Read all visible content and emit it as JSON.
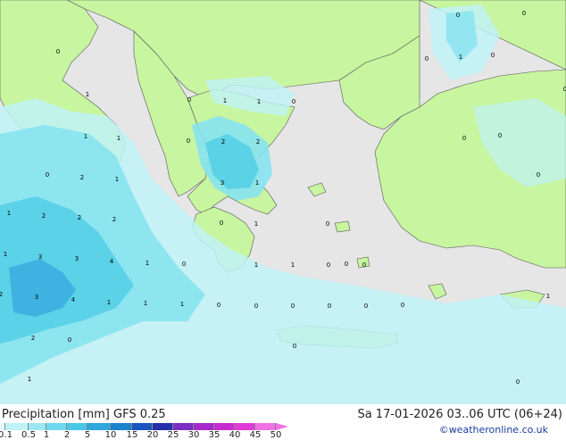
{
  "title": "Precipitation [mm]  GFS 0.25",
  "datetime": "Sa 17-01-2026 03..06 UTC (06+24)",
  "credit": "©weatheronline.co.uk",
  "colors": {
    "sea": "#e6e6e6",
    "land": "#c8f5a0",
    "border": "#888888",
    "coast": "#555555",
    "precip_light": "#bff2f7",
    "precip_mid": "#86e3f0",
    "precip_strong": "#55cfe6",
    "precip_heavy": "#3aaee0"
  },
  "legend": {
    "labels": [
      "0.1",
      "0.5",
      "1",
      "2",
      "5",
      "10",
      "15",
      "20",
      "25",
      "30",
      "35",
      "40",
      "45",
      "50"
    ],
    "colors": [
      "#e8f8fa",
      "#bff2f7",
      "#9ae8f4",
      "#6fd9ee",
      "#4ac6e6",
      "#2fa7dc",
      "#1b82cc",
      "#1a55c0",
      "#2530a8",
      "#7a2fc0",
      "#a62ac9",
      "#c72ccf",
      "#e03ad8",
      "#f070e6"
    ]
  },
  "values": [
    {
      "t": "0"
    },
    {
      "t": "0"
    },
    {
      "t": "0"
    },
    {
      "t": "0"
    },
    {
      "t": "1"
    },
    {
      "t": "0"
    },
    {
      "t": "0"
    },
    {
      "t": "1"
    },
    {
      "t": "0"
    },
    {
      "t": "1"
    },
    {
      "t": "1"
    },
    {
      "t": "0"
    },
    {
      "t": "1"
    },
    {
      "t": "1"
    },
    {
      "t": "0"
    },
    {
      "t": "0"
    },
    {
      "t": "2"
    },
    {
      "t": "2"
    },
    {
      "t": "0"
    },
    {
      "t": "0"
    },
    {
      "t": "2"
    },
    {
      "t": "1"
    },
    {
      "t": "3"
    },
    {
      "t": "1"
    },
    {
      "t": "0"
    },
    {
      "t": "1"
    },
    {
      "t": "2"
    },
    {
      "t": "2"
    },
    {
      "t": "2"
    },
    {
      "t": "0"
    },
    {
      "t": "1"
    },
    {
      "t": "0"
    },
    {
      "t": "1"
    },
    {
      "t": "3"
    },
    {
      "t": "3"
    },
    {
      "t": "4"
    },
    {
      "t": "1"
    },
    {
      "t": "0"
    },
    {
      "t": "1"
    },
    {
      "t": "1"
    },
    {
      "t": "0"
    },
    {
      "t": "0"
    },
    {
      "t": "0"
    },
    {
      "t": "2"
    },
    {
      "t": "3"
    },
    {
      "t": "4"
    },
    {
      "t": "1"
    },
    {
      "t": "1"
    },
    {
      "t": "1"
    },
    {
      "t": "0"
    },
    {
      "t": "0"
    },
    {
      "t": "0"
    },
    {
      "t": "0"
    },
    {
      "t": "0"
    },
    {
      "t": "0"
    },
    {
      "t": "1"
    },
    {
      "t": "2"
    },
    {
      "t": "0"
    },
    {
      "t": "0"
    },
    {
      "t": "1"
    },
    {
      "t": "0"
    }
  ]
}
